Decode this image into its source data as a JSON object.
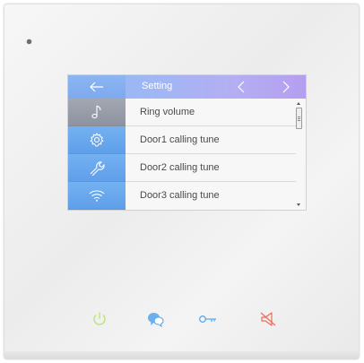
{
  "screen": {
    "title": "Setting",
    "back_icon": "arrow-left-icon",
    "prev_icon": "chevron-left-icon",
    "next_icon": "chevron-right-icon"
  },
  "sidebar": {
    "items": [
      {
        "icon": "music-note-icon",
        "active": true
      },
      {
        "icon": "gear-icon",
        "active": false
      },
      {
        "icon": "wrench-icon",
        "active": false
      },
      {
        "icon": "wifi-icon",
        "active": false
      }
    ]
  },
  "list": {
    "items": [
      {
        "label": "Ring volume"
      },
      {
        "label": "Door1 calling tune"
      },
      {
        "label": "Door2 calling tune"
      },
      {
        "label": "Door3 calling tune"
      }
    ]
  },
  "hardware_buttons": [
    {
      "icon": "power-icon",
      "color": "#b9e36a"
    },
    {
      "icon": "intercom-chat-icon",
      "color": "#5ba8ee"
    },
    {
      "icon": "key-icon",
      "color": "#5ba8ee"
    },
    {
      "icon": "mute-speaker-icon",
      "color": "#ee6a5b"
    }
  ],
  "colors": {
    "titlebar_gradient_start": "#8fbaf4",
    "titlebar_gradient_end": "#b59ef0",
    "sidebar_blue": "#6aa8ef",
    "sidebar_active_gray": "#989eaa"
  }
}
